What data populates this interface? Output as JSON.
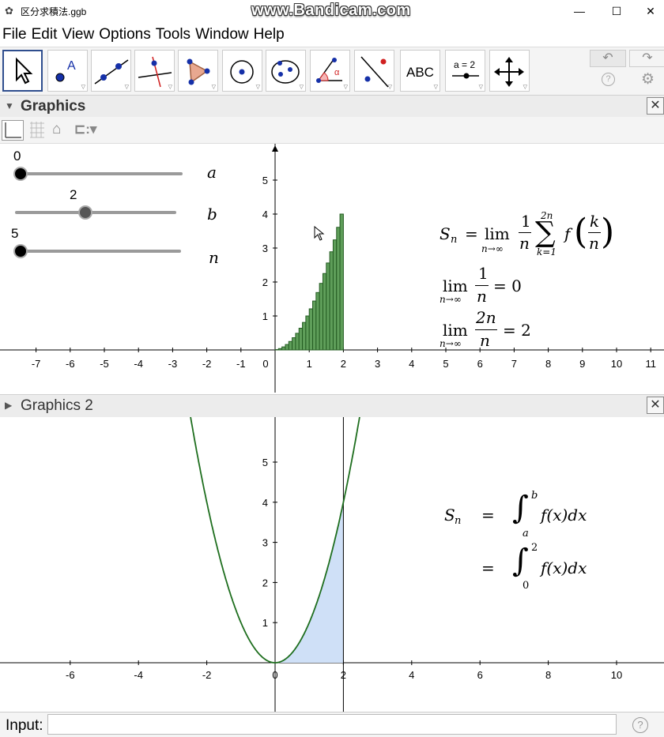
{
  "window": {
    "title": "区分求積法.ggb",
    "watermark": "www.Bandicam.com",
    "minimize": "—",
    "maximize": "☐",
    "close": "✕"
  },
  "menu": [
    "File",
    "Edit",
    "View",
    "Options",
    "Tools",
    "Window",
    "Help"
  ],
  "toolbar": {
    "tools": [
      "move-tool",
      "point-tool",
      "line-tool",
      "perpendicular-line-tool",
      "polygon-tool",
      "circle-tool",
      "conic-tool",
      "angle-tool",
      "reflect-tool",
      "text-tool",
      "slider-tool",
      "move-graphics-tool"
    ],
    "text_tool_label": "ABC",
    "slider_tool_label": "a = 2",
    "angle_tool_label": "α",
    "undo_icon": "↶",
    "redo_icon": "↷",
    "help_icon": "?",
    "settings_icon": "⚙"
  },
  "graphics1": {
    "header": "Graphics",
    "close_icon": "✕",
    "sliders": [
      {
        "name": "a",
        "value": "0",
        "fraction": 0.0
      },
      {
        "name": "b",
        "value": "2",
        "fraction": 0.4
      },
      {
        "name": "n",
        "value": "5",
        "fraction": 0.0
      }
    ],
    "x_ticks": [
      "-7",
      "-6",
      "-5",
      "-4",
      "-3",
      "-2",
      "-1",
      "1",
      "2",
      "3",
      "4",
      "5",
      "6",
      "7",
      "8",
      "9",
      "10",
      "11"
    ],
    "y_ticks": [
      "1",
      "2",
      "3",
      "4",
      "5"
    ],
    "origin_label": "0",
    "formula": {
      "sn_lhs": "S",
      "sn_sub": "n",
      "lim_word": "lim",
      "lim_sub": "n→∞",
      "one": "1",
      "n": "n",
      "sum_top": "2n",
      "sum_bottom": "k=1",
      "sum_symbol": "∑",
      "f": "f",
      "k": "k",
      "lim1_result": "= 0",
      "two_n": "2n",
      "lim2_result": "= 2"
    }
  },
  "graphics2": {
    "header": "Graphics 2",
    "close_icon": "✕",
    "x_ticks": [
      "-6",
      "-4",
      "-2",
      "0",
      "2",
      "4",
      "6",
      "8",
      "10"
    ],
    "y_ticks": [
      "1",
      "2",
      "3",
      "4",
      "5"
    ],
    "formula": {
      "sn": "S",
      "sub": "n",
      "eq": "=",
      "int_symbol": "∫",
      "upper_b": "b",
      "lower_a": "a",
      "integrand": "f(x)dx",
      "upper_2": "2",
      "lower_0": "0"
    }
  },
  "chart_data": {
    "type": "bar",
    "x_step": 0.1,
    "bars_x_start": [
      0,
      0.1,
      0.2,
      0.3,
      0.4,
      0.5,
      0.6,
      0.7,
      0.8,
      0.9,
      1.0,
      1.1,
      1.2,
      1.3,
      1.4,
      1.5,
      1.6,
      1.7,
      1.8,
      1.9
    ],
    "values": [
      0.01,
      0.04,
      0.09,
      0.16,
      0.25,
      0.36,
      0.49,
      0.64,
      0.81,
      1.0,
      1.21,
      1.44,
      1.69,
      1.96,
      2.25,
      2.56,
      2.89,
      3.24,
      3.61,
      4.0
    ],
    "curve": "y = x^2",
    "integral_interval": [
      0,
      2
    ],
    "colors": {
      "bars_fill": "#5f9e5a",
      "bars_stroke": "#245c22",
      "curve": "#1e6e1e",
      "shade": "#cfe0f7"
    }
  },
  "inputbar": {
    "label": "Input:",
    "value": "",
    "help": "?"
  }
}
